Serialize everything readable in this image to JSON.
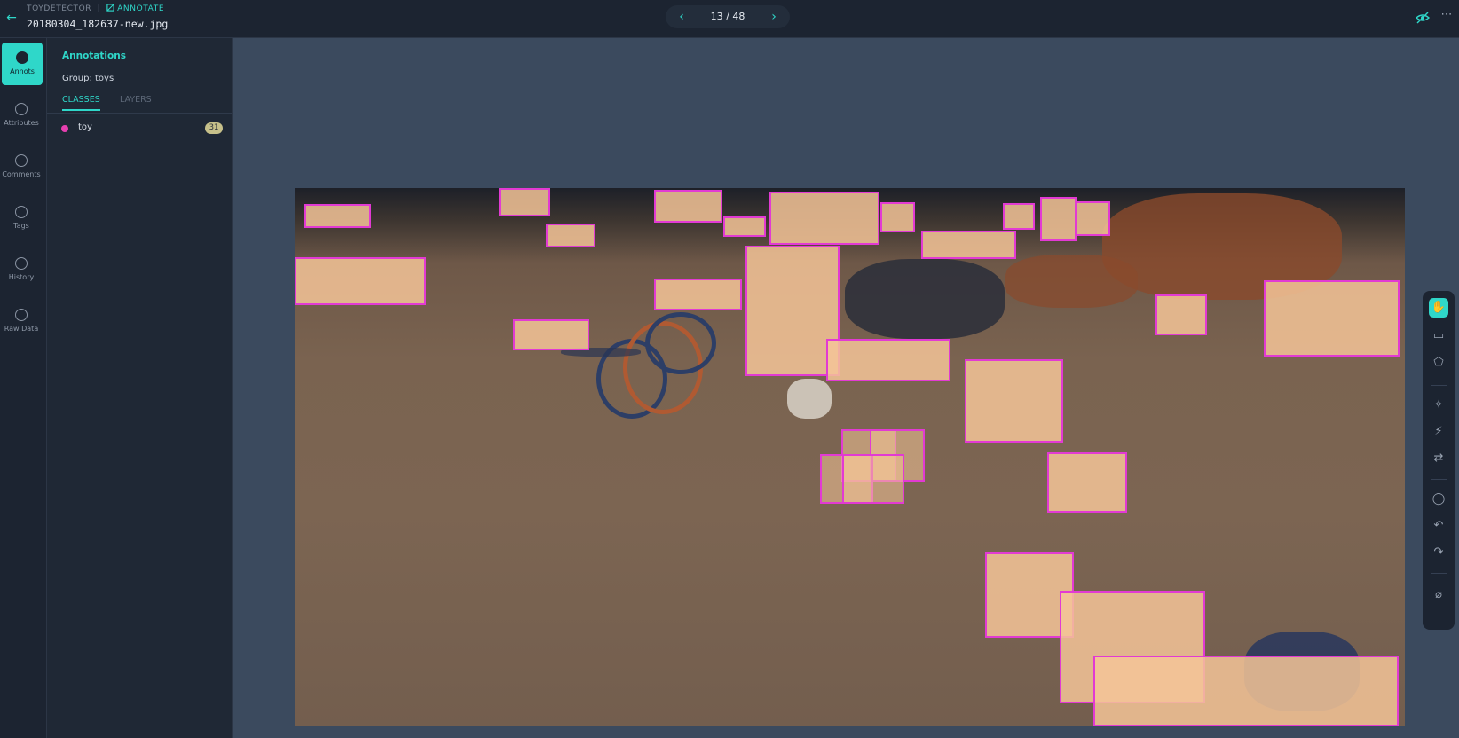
{
  "header": {
    "project": "TOYDETECTOR",
    "separator": "|",
    "mode_icon": "annotate-icon",
    "mode": "ANNOTATE",
    "filename": "20180304_182637-new.jpg",
    "pager": "13 / 48",
    "prev_glyph": "‹",
    "next_glyph": "›",
    "back_glyph": "←",
    "more_glyph": "⋯"
  },
  "rail": {
    "items": [
      {
        "label": "Annots",
        "icon": "annotation-icon",
        "active": true
      },
      {
        "label": "Attributes",
        "icon": "attributes-icon"
      },
      {
        "label": "Comments",
        "icon": "comments-icon"
      },
      {
        "label": "Tags",
        "icon": "tags-icon"
      },
      {
        "label": "History",
        "icon": "history-icon"
      },
      {
        "label": "Raw Data",
        "icon": "raw-data-icon"
      }
    ]
  },
  "panel": {
    "title": "Annotations",
    "group": "Group: toys",
    "tabs": [
      "CLASSES",
      "LAYERS"
    ],
    "classes": [
      {
        "name": "toy",
        "count": "31",
        "color": "#e63fb0"
      }
    ]
  },
  "canvas": {
    "box_color": "#e23ad3",
    "fill_color": "#f4c498"
  },
  "toolbar": {
    "tools": [
      {
        "name": "pan-tool",
        "glyph": "✋",
        "active": true
      },
      {
        "name": "bbox-tool",
        "glyph": "▭"
      },
      {
        "name": "polygon-tool",
        "glyph": "⬠"
      },
      {
        "name": "smart-select-tool",
        "glyph": "✧"
      },
      {
        "name": "magic-wand-tool",
        "glyph": "⚡"
      },
      {
        "name": "transfer-tool",
        "glyph": "⇄"
      },
      {
        "name": "comment-tool",
        "glyph": "◯"
      },
      {
        "name": "undo-tool",
        "glyph": "↶"
      },
      {
        "name": "redo-tool",
        "glyph": "↷"
      },
      {
        "name": "clear-tool",
        "glyph": "⌀"
      }
    ]
  }
}
